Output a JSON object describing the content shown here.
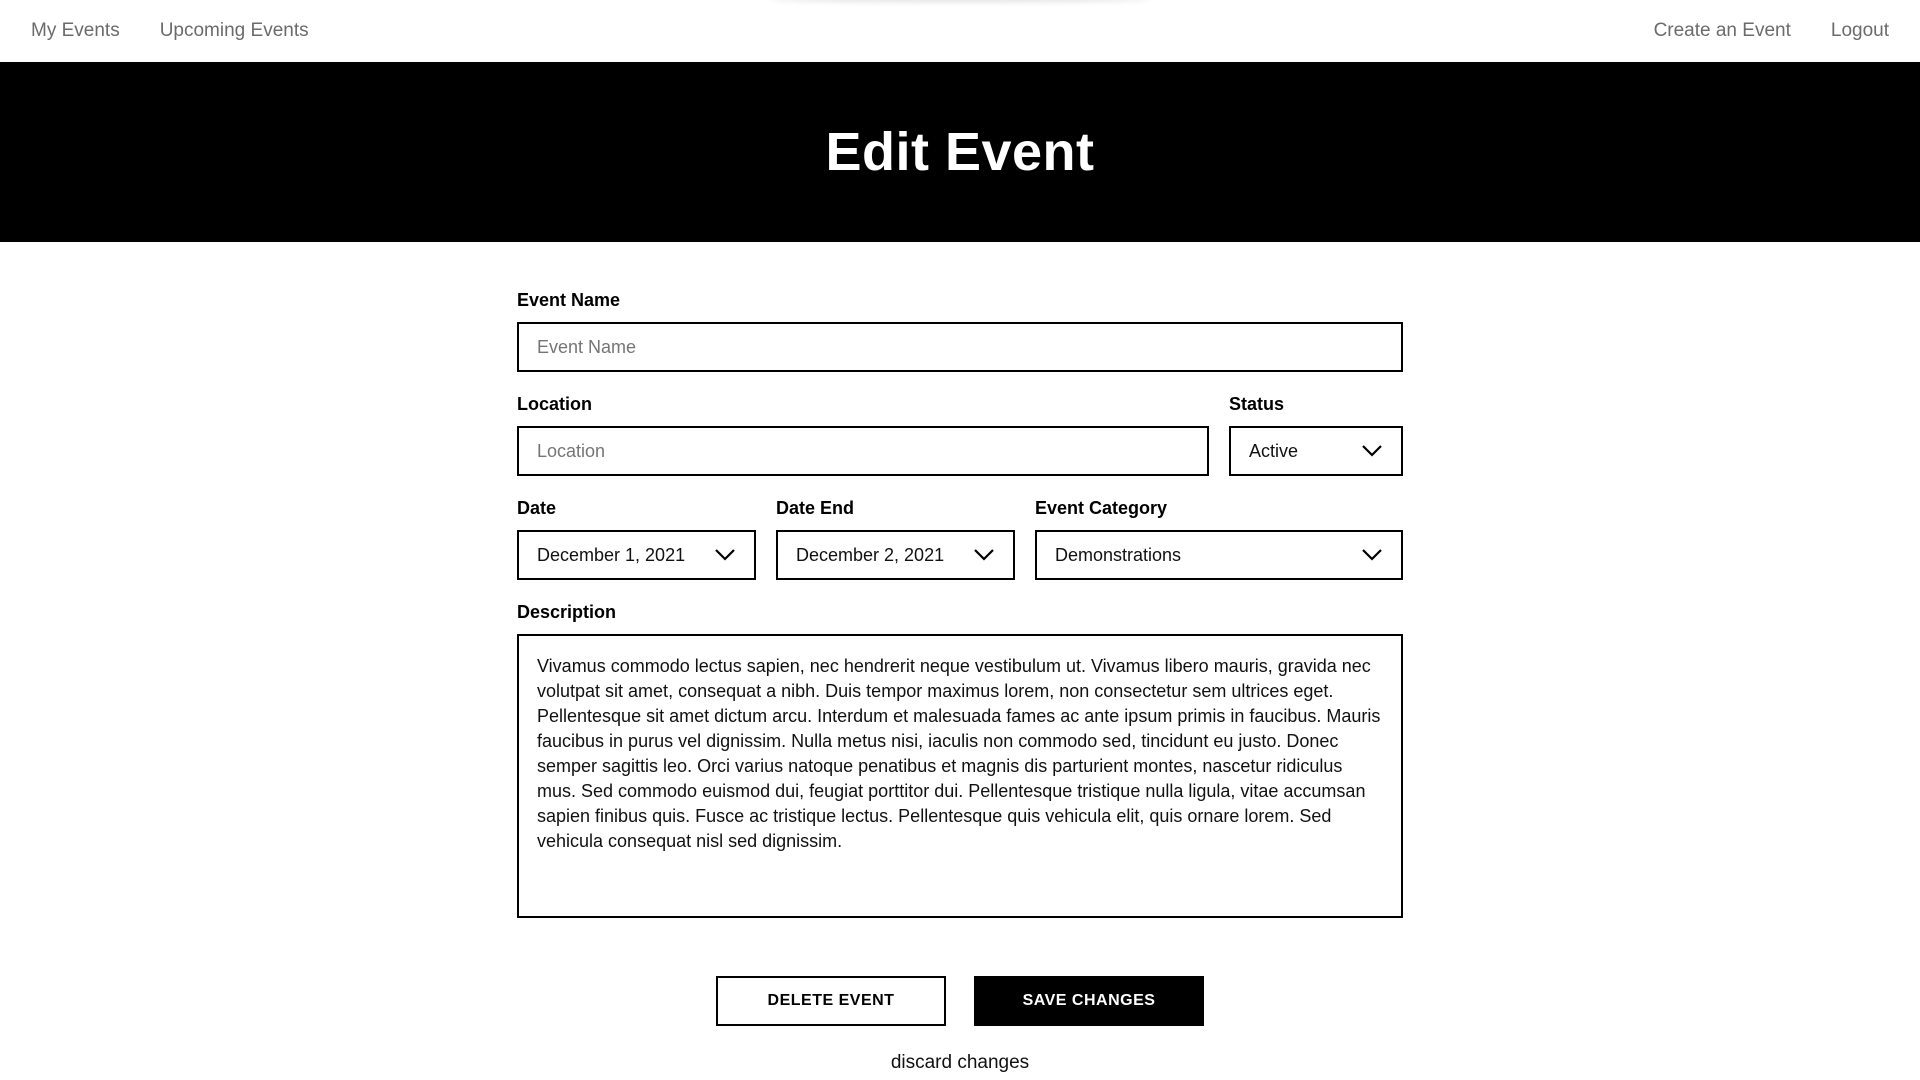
{
  "nav": {
    "left": [
      "My Events",
      "Upcoming Events"
    ],
    "right": [
      "Create an Event",
      "Logout"
    ]
  },
  "hero": {
    "title": "Edit Event"
  },
  "form": {
    "event_name": {
      "label": "Event Name",
      "placeholder": "Event Name"
    },
    "location": {
      "label": "Location",
      "placeholder": "Location"
    },
    "status": {
      "label": "Status",
      "value": "Active"
    },
    "date": {
      "label": "Date",
      "value": "December 1, 2021"
    },
    "date_end": {
      "label": "Date End",
      "value": "December 2, 2021"
    },
    "category": {
      "label": "Event Category",
      "value": "Demonstrations"
    },
    "description": {
      "label": "Description",
      "value": "Vivamus commodo lectus sapien, nec hendrerit neque vestibulum ut. Vivamus libero mauris, gravida nec volutpat sit amet, consequat a nibh. Duis tempor maximus lorem, non consectetur sem ultrices eget. Pellentesque sit amet dictum arcu. Interdum et malesuada fames ac ante ipsum primis in faucibus. Mauris faucibus in purus vel dignissim. Nulla metus nisi, iaculis non commodo sed, tincidunt eu justo. Donec semper sagittis leo. Orci varius natoque penatibus et magnis dis parturient montes, nascetur ridiculus mus. Sed commodo euismod dui, feugiat porttitor dui. Pellentesque tristique nulla ligula, vitae accumsan sapien finibus quis. Fusce ac tristique lectus. Pellentesque quis vehicula elit, quis ornare lorem. Sed vehicula consequat nisl sed dignissim."
    }
  },
  "actions": {
    "delete_label": "DELETE EVENT",
    "save_label": "SAVE CHANGES",
    "discard_label": "discard changes"
  },
  "icons": {
    "dropdown": "chevron-down-icon"
  },
  "colors": {
    "hero_bg": "#000000",
    "nav_text": "#6b6b6b",
    "primary_button": "#000000"
  }
}
